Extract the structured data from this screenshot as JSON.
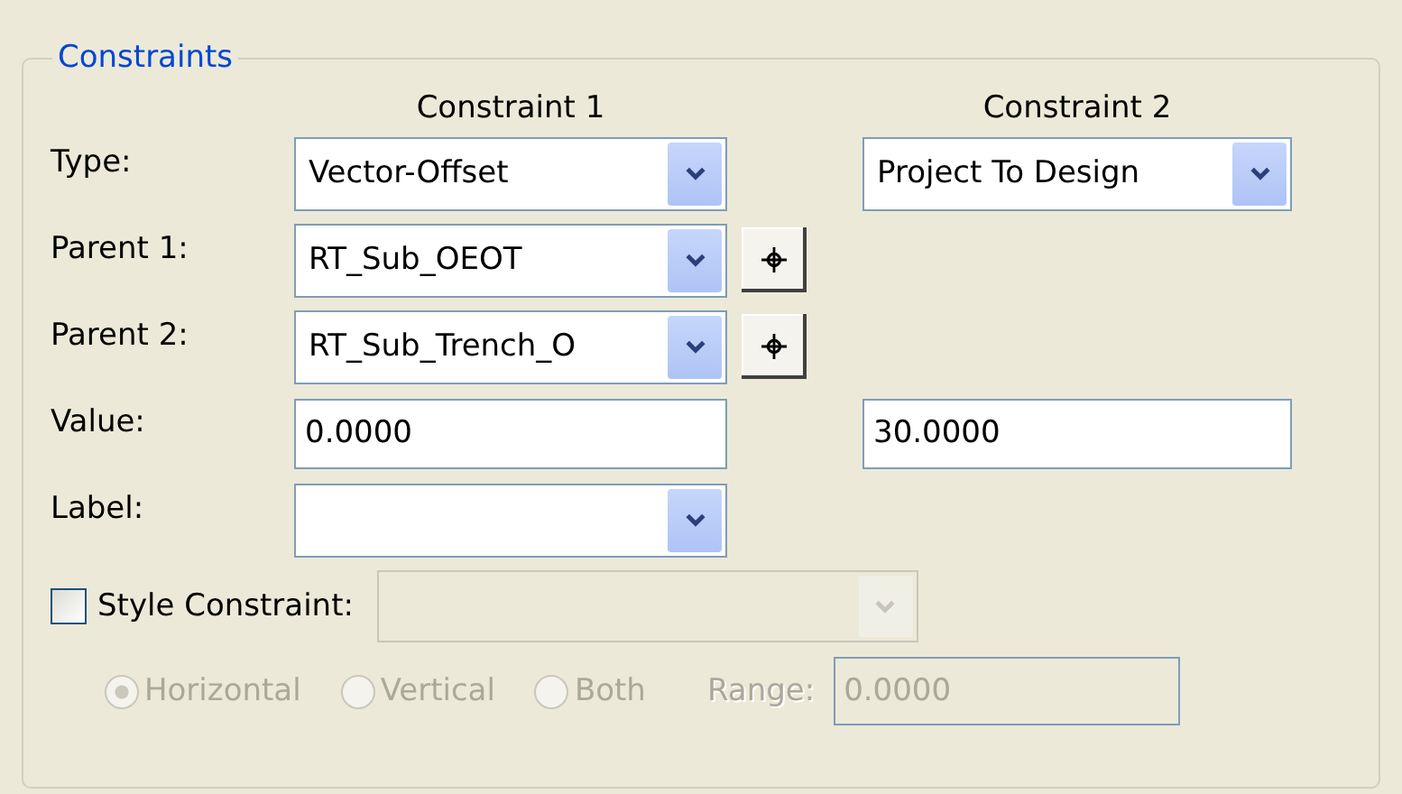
{
  "group": {
    "title": "Constraints"
  },
  "columns": [
    "Constraint 1",
    "Constraint 2"
  ],
  "rows": [
    {
      "label": "Type:",
      "cells": [
        {
          "kind": "combo",
          "value": "Vector-Offset"
        },
        {
          "kind": "combo",
          "value": "Project To Design"
        }
      ]
    },
    {
      "label": "Parent 1:",
      "cells": [
        {
          "kind": "combo-pick",
          "value": "RT_Sub_OEOT"
        }
      ]
    },
    {
      "label": "Parent 2:",
      "cells": [
        {
          "kind": "combo-pick",
          "value": "RT_Sub_Trench_O"
        }
      ]
    },
    {
      "label": "Value:",
      "cells": [
        {
          "kind": "text",
          "value": "0.0000"
        },
        {
          "kind": "text",
          "value": "30.0000"
        }
      ]
    },
    {
      "label": "Label:",
      "cells": [
        {
          "kind": "combo"
        }
      ]
    }
  ],
  "style_constraint": {
    "label": "Style Constraint:",
    "checked": false,
    "combo_disabled": true
  },
  "orientation": {
    "disabled": true,
    "options": [
      {
        "label": "Horizontal",
        "selected": true
      },
      {
        "label": "Vertical",
        "selected": false
      },
      {
        "label": "Both",
        "selected": false
      }
    ]
  },
  "range": {
    "label": "Range:",
    "value": "0.0000",
    "disabled": true
  }
}
